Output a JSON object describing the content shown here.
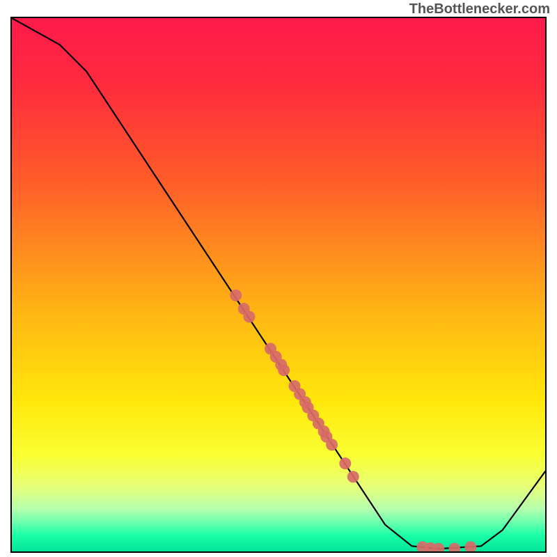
{
  "watermark": {
    "text": "TheBottlenecker.com"
  },
  "chart_data": {
    "type": "line",
    "title": "",
    "xlabel": "",
    "ylabel": "",
    "xlim": [
      0,
      100
    ],
    "ylim": [
      0,
      100
    ],
    "curve": [
      {
        "x": 0,
        "y": 100
      },
      {
        "x": 9,
        "y": 95
      },
      {
        "x": 14,
        "y": 90
      },
      {
        "x": 70,
        "y": 5
      },
      {
        "x": 75,
        "y": 1
      },
      {
        "x": 80,
        "y": 0.5
      },
      {
        "x": 88,
        "y": 1
      },
      {
        "x": 92,
        "y": 4
      },
      {
        "x": 100,
        "y": 15
      }
    ],
    "series": [
      {
        "name": "markers",
        "color": "#d86a68",
        "points": [
          {
            "x": 42.0,
            "y": 48.0
          },
          {
            "x": 43.5,
            "y": 45.5
          },
          {
            "x": 44.5,
            "y": 44.0
          },
          {
            "x": 48.5,
            "y": 38.0
          },
          {
            "x": 49.5,
            "y": 36.5
          },
          {
            "x": 50.5,
            "y": 35.0
          },
          {
            "x": 51.0,
            "y": 34.0
          },
          {
            "x": 53.0,
            "y": 31.0
          },
          {
            "x": 54.0,
            "y": 29.5
          },
          {
            "x": 55.0,
            "y": 28.0
          },
          {
            "x": 55.5,
            "y": 27.0
          },
          {
            "x": 56.5,
            "y": 25.5
          },
          {
            "x": 57.5,
            "y": 24.0
          },
          {
            "x": 58.5,
            "y": 22.5
          },
          {
            "x": 59.0,
            "y": 21.5
          },
          {
            "x": 60.0,
            "y": 20.0
          },
          {
            "x": 62.5,
            "y": 16.5
          },
          {
            "x": 64.0,
            "y": 14.0
          },
          {
            "x": 77.0,
            "y": 0.8
          },
          {
            "x": 78.5,
            "y": 0.6
          },
          {
            "x": 80.0,
            "y": 0.5
          },
          {
            "x": 83.0,
            "y": 0.5
          },
          {
            "x": 86.0,
            "y": 0.8
          }
        ]
      }
    ]
  }
}
